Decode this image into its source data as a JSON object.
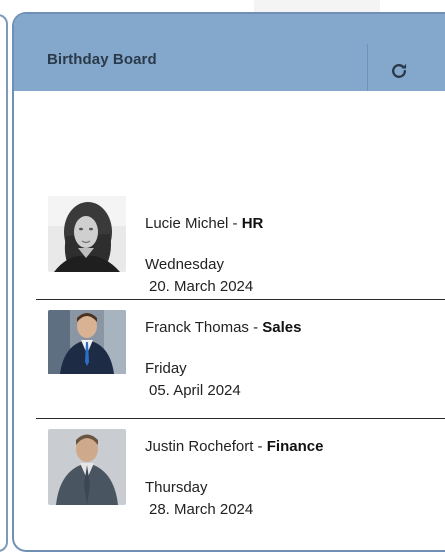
{
  "card": {
    "title": "Birthday Board",
    "refresh_icon": "refresh-icon"
  },
  "entries": [
    {
      "name": "Lucie Michel",
      "separator": " - ",
      "department": "HR",
      "weekday": "Wednesday",
      "date": "20. March 2024",
      "photo": "portrait-photo-grayscale"
    },
    {
      "name": "Franck Thomas",
      "separator": " - ",
      "department": "Sales",
      "weekday": "Friday",
      "date": "05. April 2024",
      "photo": "portrait-photo-suit"
    },
    {
      "name": "Justin Rochefort",
      "separator": " - ",
      "department": "Finance",
      "weekday": "Thursday",
      "date": "28. March 2024",
      "photo": "portrait-photo-suit-grey-bg"
    }
  ],
  "colors": {
    "header_bg": "#83a8cc",
    "card_border": "#6f90b4",
    "text": "#222222"
  }
}
